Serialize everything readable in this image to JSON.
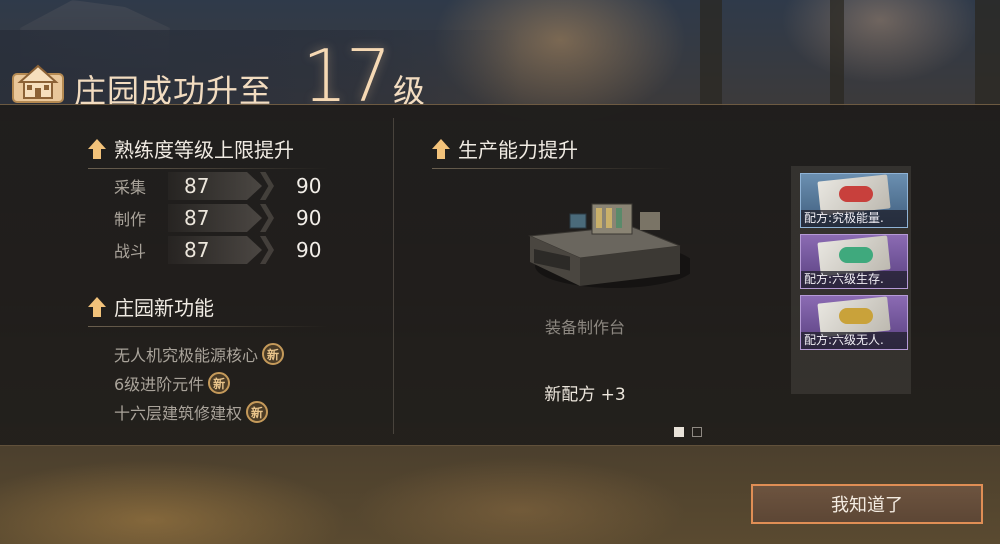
{
  "header": {
    "title": "庄园成功升至",
    "level": "17",
    "level_suffix": "级"
  },
  "proficiency": {
    "title": "熟练度等级上限提升",
    "stats": [
      {
        "label": "采集",
        "from": "87",
        "to": "90"
      },
      {
        "label": "制作",
        "from": "87",
        "to": "90"
      },
      {
        "label": "战斗",
        "from": "87",
        "to": "90"
      }
    ]
  },
  "features": {
    "title": "庄园新功能",
    "badge": "新",
    "items": [
      {
        "label": "无人机究极能源核心"
      },
      {
        "label": "6级进阶元件"
      },
      {
        "label": "十六层建筑修建权"
      }
    ]
  },
  "production": {
    "title": "生产能力提升",
    "bench_name": "装备制作台",
    "recipe_count": "新配方 +3",
    "recipes": [
      {
        "label": "配方:究极能量.",
        "rarity": "blue",
        "item_color": "#c8403c"
      },
      {
        "label": "配方:六级生存.",
        "rarity": "purple",
        "item_color": "#3fa97d"
      },
      {
        "label": "配方:六级无人.",
        "rarity": "purple",
        "item_color": "#c9a23a"
      }
    ],
    "pages": {
      "current": 1,
      "total": 2
    }
  },
  "confirm_label": "我知道了"
}
